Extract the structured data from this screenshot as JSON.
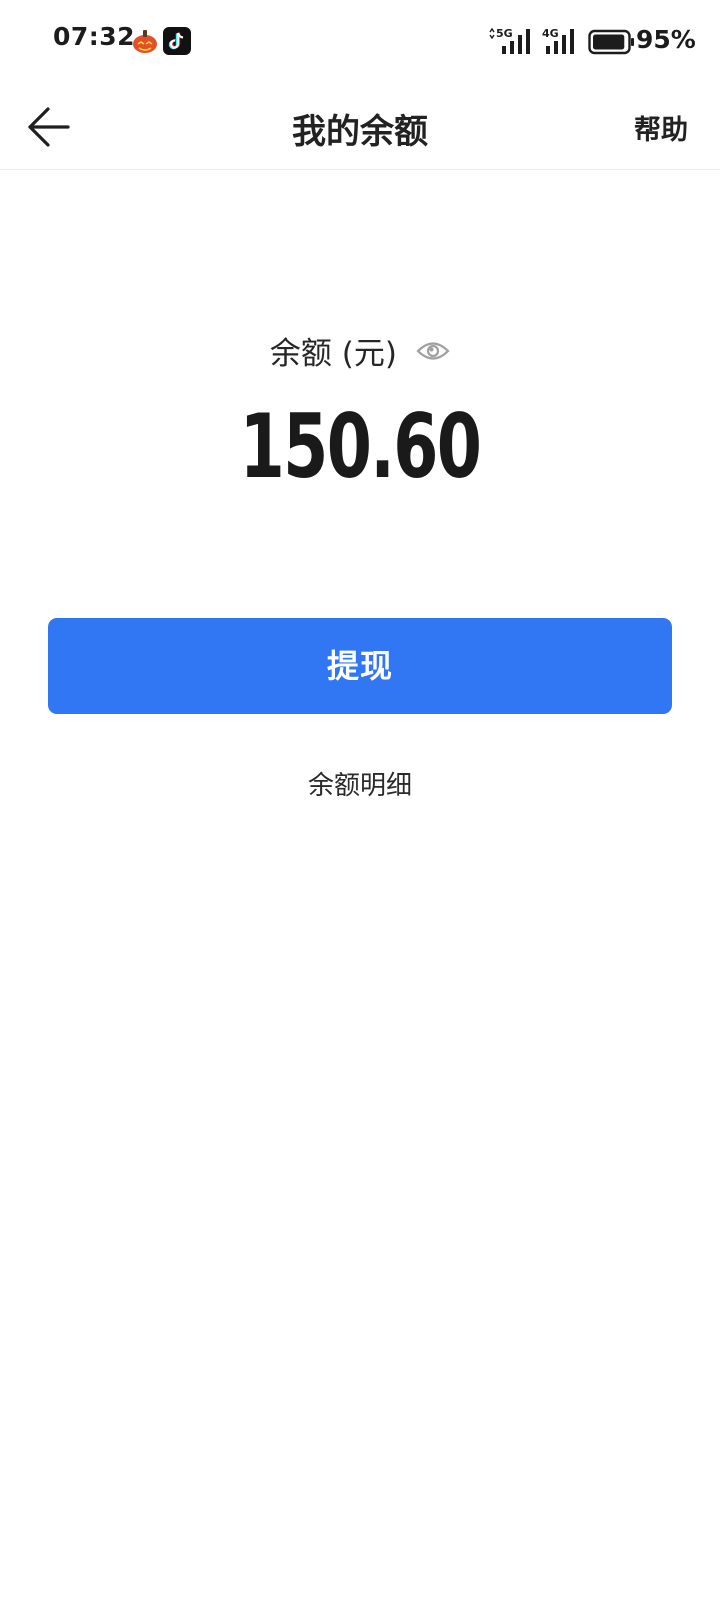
{
  "status_bar": {
    "time": "07:32",
    "notification_icons": [
      "pumpkin-app-icon",
      "tiktok-icon"
    ],
    "network_1": "5G",
    "network_2": "4G",
    "battery_percent": "95%",
    "battery_level": 0.95
  },
  "nav": {
    "title": "我的余额",
    "help_label": "帮助",
    "back_icon": "arrow-left-icon"
  },
  "balance": {
    "label": "余额 (元)",
    "amount": "150.60",
    "visibility_icon": "eye-icon"
  },
  "actions": {
    "withdraw_label": "提现",
    "details_label": "余额明细"
  },
  "colors": {
    "primary": "#3176f2",
    "text": "#222222",
    "icon_gray": "#a0a0a0"
  }
}
